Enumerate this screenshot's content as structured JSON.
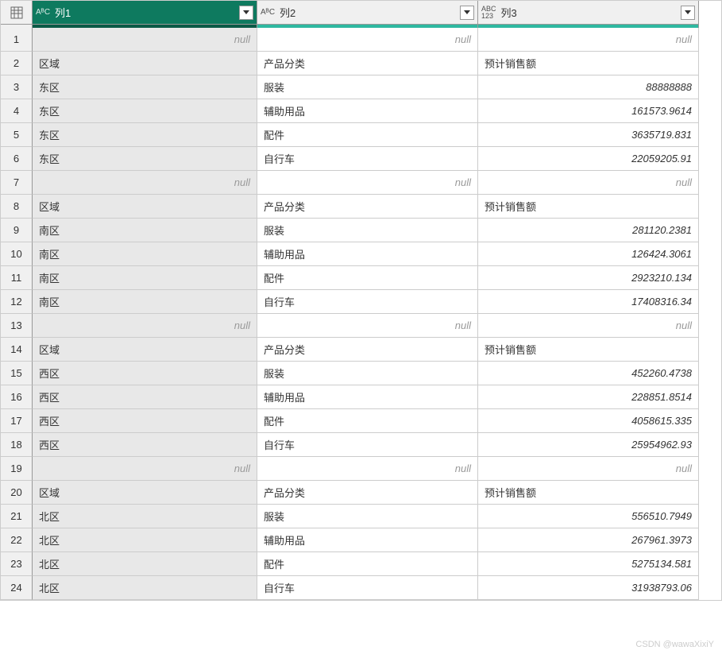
{
  "columns": [
    {
      "name": "列1",
      "type": "text",
      "selected": true
    },
    {
      "name": "列2",
      "type": "text",
      "selected": false
    },
    {
      "name": "列3",
      "type": "any",
      "selected": false
    }
  ],
  "type_labels": {
    "text": "AᴮC",
    "any_top": "ABC",
    "any_bottom": "123"
  },
  "rows": [
    {
      "n": "1",
      "c1": null,
      "c2": null,
      "c3": null
    },
    {
      "n": "2",
      "c1": "区域",
      "c2": "产品分类",
      "c3": "预计销售额"
    },
    {
      "n": "3",
      "c1": "东区",
      "c2": "服装",
      "c3": "88888888"
    },
    {
      "n": "4",
      "c1": "东区",
      "c2": "辅助用品",
      "c3": "161573.9614"
    },
    {
      "n": "5",
      "c1": "东区",
      "c2": "配件",
      "c3": "3635719.831"
    },
    {
      "n": "6",
      "c1": "东区",
      "c2": "自行车",
      "c3": "22059205.91"
    },
    {
      "n": "7",
      "c1": null,
      "c2": null,
      "c3": null
    },
    {
      "n": "8",
      "c1": "区域",
      "c2": "产品分类",
      "c3": "预计销售额"
    },
    {
      "n": "9",
      "c1": "南区",
      "c2": "服装",
      "c3": "281120.2381"
    },
    {
      "n": "10",
      "c1": "南区",
      "c2": "辅助用品",
      "c3": "126424.3061"
    },
    {
      "n": "11",
      "c1": "南区",
      "c2": "配件",
      "c3": "2923210.134"
    },
    {
      "n": "12",
      "c1": "南区",
      "c2": "自行车",
      "c3": "17408316.34"
    },
    {
      "n": "13",
      "c1": null,
      "c2": null,
      "c3": null
    },
    {
      "n": "14",
      "c1": "区域",
      "c2": "产品分类",
      "c3": "预计销售额"
    },
    {
      "n": "15",
      "c1": "西区",
      "c2": "服装",
      "c3": "452260.4738"
    },
    {
      "n": "16",
      "c1": "西区",
      "c2": "辅助用品",
      "c3": "228851.8514"
    },
    {
      "n": "17",
      "c1": "西区",
      "c2": "配件",
      "c3": "4058615.335"
    },
    {
      "n": "18",
      "c1": "西区",
      "c2": "自行车",
      "c3": "25954962.93"
    },
    {
      "n": "19",
      "c1": null,
      "c2": null,
      "c3": null
    },
    {
      "n": "20",
      "c1": "区域",
      "c2": "产品分类",
      "c3": "预计销售额"
    },
    {
      "n": "21",
      "c1": "北区",
      "c2": "服装",
      "c3": "556510.7949"
    },
    {
      "n": "22",
      "c1": "北区",
      "c2": "辅助用品",
      "c3": "267961.3973"
    },
    {
      "n": "23",
      "c1": "北区",
      "c2": "配件",
      "c3": "5275134.581"
    },
    {
      "n": "24",
      "c1": "北区",
      "c2": "自行车",
      "c3": "31938793.06"
    }
  ],
  "null_label": "null",
  "numeric_col3_rows": [
    "3",
    "4",
    "5",
    "6",
    "9",
    "10",
    "11",
    "12",
    "15",
    "16",
    "17",
    "18",
    "21",
    "22",
    "23",
    "24"
  ],
  "watermark": "CSDN @wawaXixiY"
}
